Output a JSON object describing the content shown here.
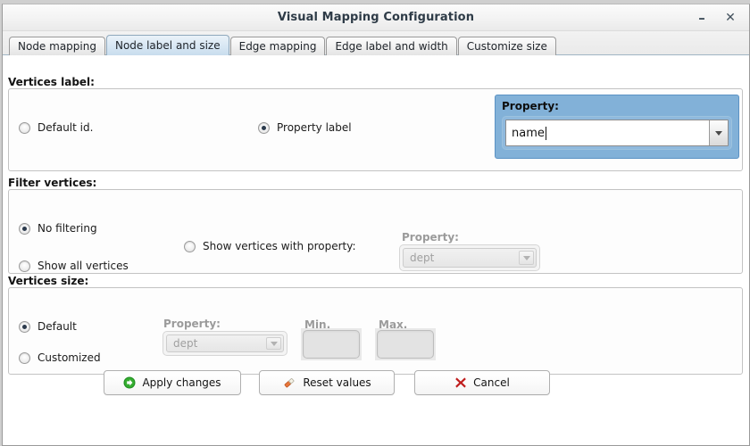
{
  "window": {
    "title": "Visual Mapping Configuration",
    "minimize_label": "–",
    "close_label": "✕"
  },
  "tabs": [
    {
      "label": "Node mapping",
      "selected": false
    },
    {
      "label": "Node label and size",
      "selected": true
    },
    {
      "label": "Edge mapping",
      "selected": false
    },
    {
      "label": "Edge label and width",
      "selected": false
    },
    {
      "label": "Customize size",
      "selected": false
    }
  ],
  "vertices_label": {
    "group_title": "Vertices label:",
    "option_default_id": "Default id.",
    "option_property_label": "Property label",
    "selected": "Property label",
    "property": {
      "caption": "Property:",
      "value": "name",
      "focused": true
    }
  },
  "filter_vertices": {
    "group_title": "Filter vertices:",
    "option_no_filtering": "No filtering",
    "option_show_all_vertices": "Show all vertices",
    "option_show_vertices_with_property": "Show vertices with property:",
    "selected": "No filtering",
    "property": {
      "caption": "Property:",
      "value": "dept",
      "enabled": false
    }
  },
  "vertices_size": {
    "group_title": "Vertices size:",
    "option_default": "Default",
    "option_customized": "Customized",
    "selected": "Default",
    "property": {
      "caption": "Property:",
      "value": "dept",
      "enabled": false
    },
    "min": {
      "caption": "Min.",
      "value": "",
      "enabled": false
    },
    "max": {
      "caption": "Max.",
      "value": "",
      "enabled": false
    }
  },
  "buttons": {
    "apply": {
      "label": "Apply changes",
      "icon": "green-arrow-circle-icon"
    },
    "reset": {
      "label": "Reset values",
      "icon": "eraser-pencil-icon"
    },
    "cancel": {
      "label": "Cancel",
      "icon": "red-x-icon"
    }
  },
  "colors": {
    "highlight_panel": "#82b1d8",
    "selected_tab": "#d6e6f3",
    "apply_icon": "#1c9e20",
    "reset_icon": "#e8763a",
    "cancel_icon": "#c01d1d"
  }
}
